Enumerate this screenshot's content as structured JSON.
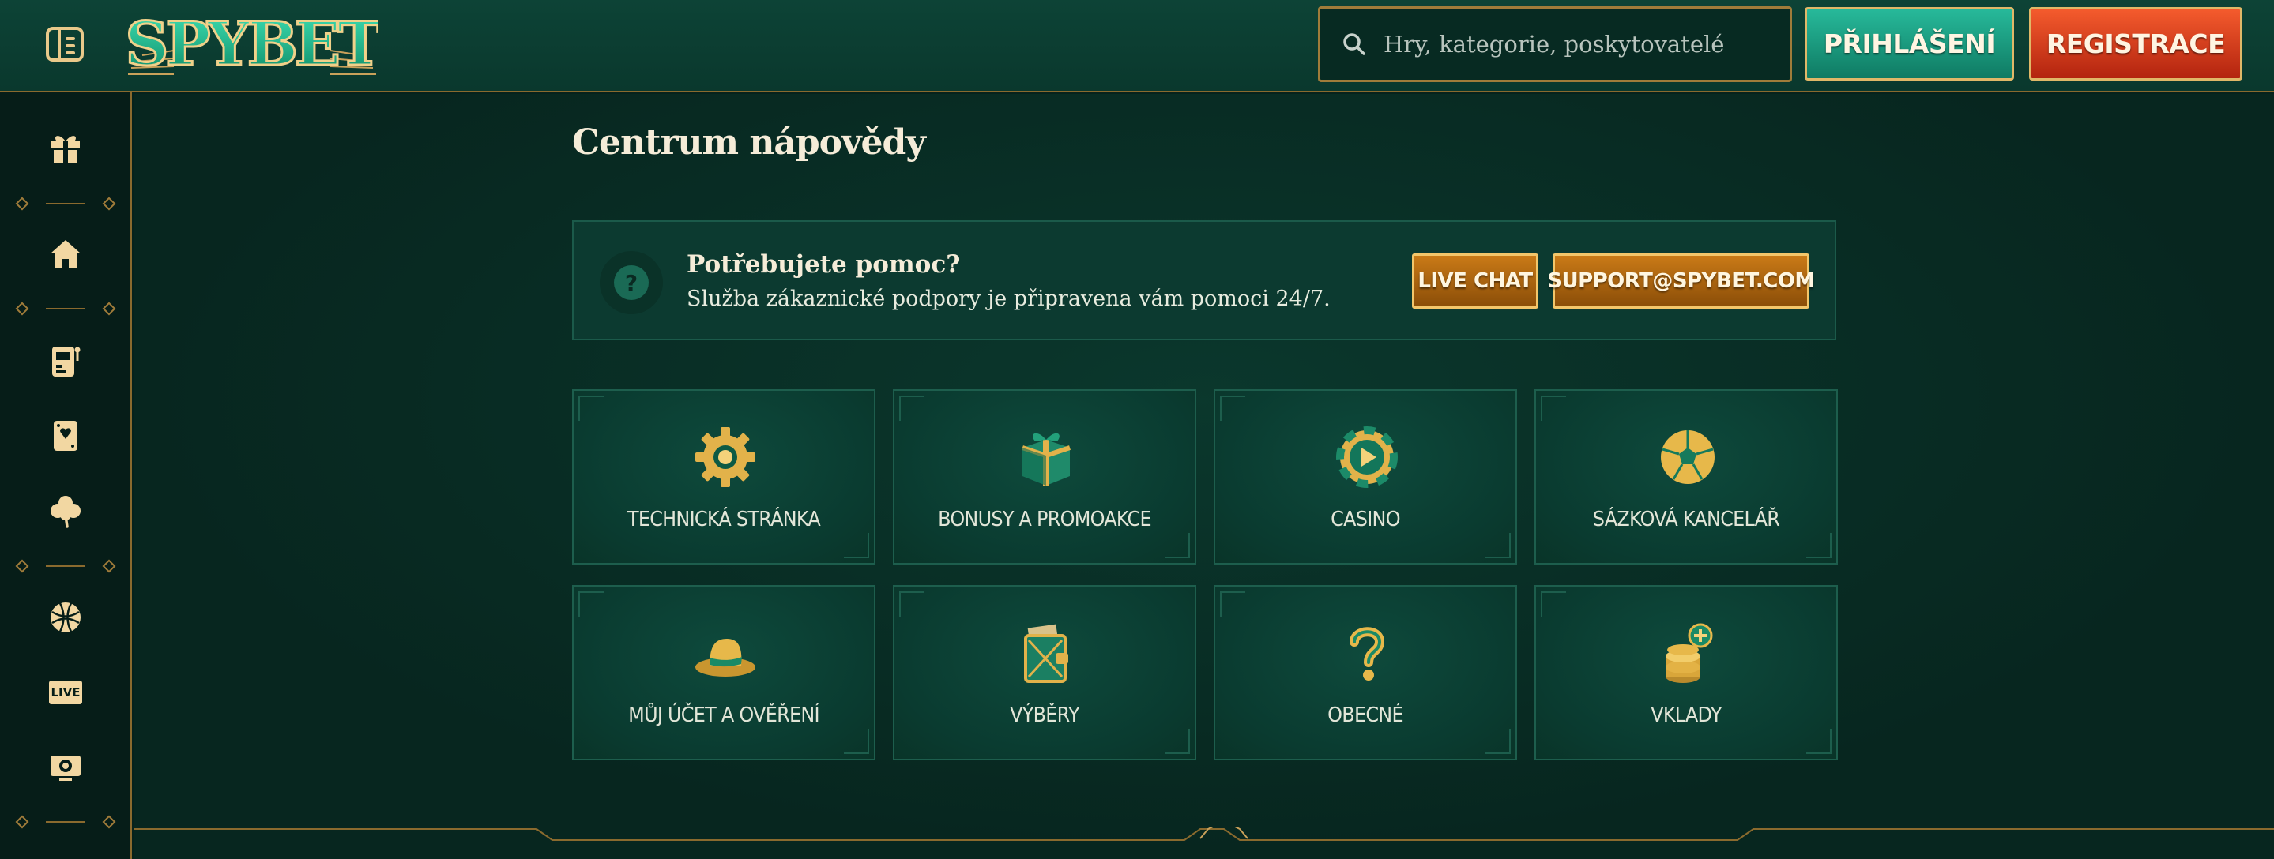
{
  "header": {
    "logo_text": "SPYBET",
    "search_placeholder": "Hry, kategorie, poskytovatelé",
    "login_label": "PŘIHLÁŠENÍ",
    "register_label": "REGISTRACE"
  },
  "sidebar": {
    "items": [
      {
        "icon": "gift-icon"
      },
      {
        "icon": "home-icon"
      },
      {
        "icon": "slot-machine-icon"
      },
      {
        "icon": "playing-card-icon"
      },
      {
        "icon": "clover-icon"
      },
      {
        "icon": "sports-ball-icon"
      },
      {
        "icon": "live-icon",
        "label": "LIVE"
      },
      {
        "icon": "virtual-sports-icon"
      }
    ]
  },
  "main": {
    "title": "Centrum nápovědy",
    "help": {
      "title": "Potřebujete pomoc?",
      "subtitle": "Služba zákaznické podpory je připravena vám pomoci 24/7.",
      "chat_label": "LIVE CHAT",
      "email_label": "SUPPORT@SPYBET.COM"
    },
    "categories": [
      {
        "label": "TECHNICKÁ STRÁNKA",
        "icon": "gear-icon"
      },
      {
        "label": "BONUSY A PROMOAKCE",
        "icon": "gift-box-icon"
      },
      {
        "label": "CASINO",
        "icon": "casino-chip-icon"
      },
      {
        "label": "SÁZKOVÁ KANCELÁŘ",
        "icon": "soccer-ball-icon"
      },
      {
        "label": "MŮJ ÚČET A OVĚŘENÍ",
        "icon": "hat-icon"
      },
      {
        "label": "VÝBĚRY",
        "icon": "wallet-icon"
      },
      {
        "label": "OBECNÉ",
        "icon": "question-mark-icon"
      },
      {
        "label": "VKLADY",
        "icon": "coin-stack-icon"
      }
    ]
  },
  "colors": {
    "accent_gold": "#e9c98a",
    "login_green": "#1a9c80",
    "register_red": "#e0441f",
    "background": "#07261f"
  }
}
